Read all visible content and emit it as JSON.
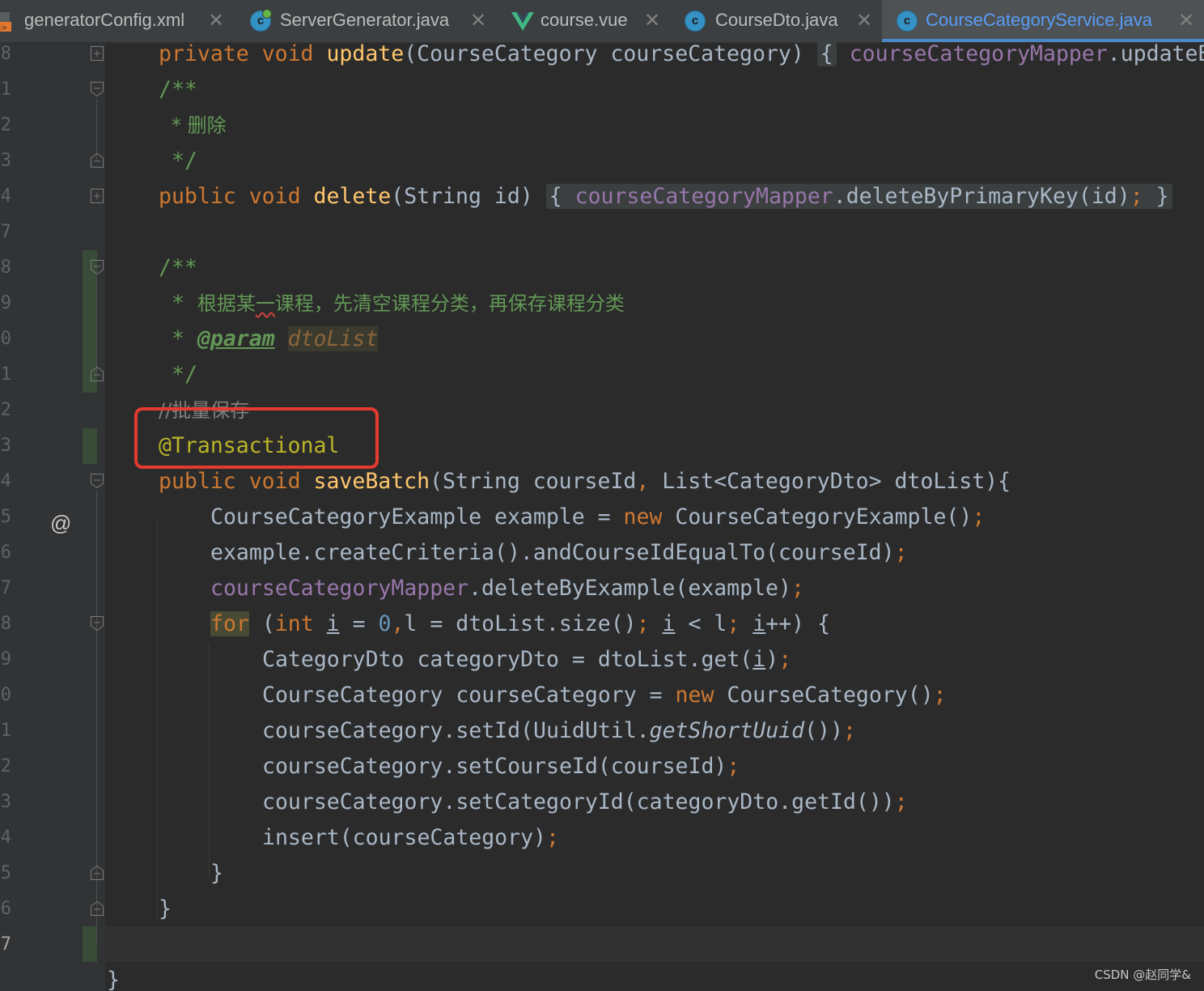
{
  "tabs": [
    {
      "label": "generatorConfig.xml",
      "icon": "xml-file-icon"
    },
    {
      "label": "ServerGenerator.java",
      "icon": "java-class-runnable-icon"
    },
    {
      "label": "course.vue",
      "icon": "vue-file-icon"
    },
    {
      "label": "CourseDto.java",
      "icon": "java-class-icon"
    },
    {
      "label": "CourseCategoryService.java",
      "icon": "java-class-icon",
      "active": true
    }
  ],
  "gutter": {
    "line_numbers": [
      "8",
      "1",
      "2",
      "3",
      "4",
      "7",
      "8",
      "9",
      "0",
      "1",
      "2",
      "3",
      "4",
      "5",
      "6",
      "7",
      "8",
      "9",
      "0",
      "1",
      "2",
      "3",
      "4",
      "5",
      "6",
      "7",
      ""
    ],
    "override_marker": "@"
  },
  "code": {
    "update_sig": {
      "kw1": "private",
      "kw2": "void",
      "name": "update",
      "open": "(CourseCategory courseCategory)",
      "brace": "{",
      "field": "courseCategoryMapper",
      "rest": ".updateB"
    },
    "doc1_open": "/**",
    "doc1_text": "* 删除",
    "doc1_close": "*/",
    "delete_sig": {
      "kw1": "public",
      "kw2": "void",
      "name": "delete",
      "params": "(String id)",
      "brace_open": "{",
      "field": "courseCategoryMapper",
      "call": ".deleteByPrimaryKey(id)",
      "semi": ";",
      "brace_close": "}"
    },
    "doc2_open": "/**",
    "doc2_text_star": "* ",
    "doc2_text_a": "根据某",
    "doc2_text_b": "一",
    "doc2_text_c": "课程，先清空课程分类，再保存课程分类",
    "doc2_param_star": "* ",
    "doc2_param_tag": "@param",
    "doc2_param_name": "dtoList",
    "doc2_close": "*/",
    "line_comment": "//批量保存",
    "annotation": "@Transactional",
    "save_sig": {
      "kw1": "public",
      "kw2": "void",
      "name": "saveBatch",
      "params_a": "(String courseId",
      "comma": ",",
      "params_b": " List<CategoryDto> dtoList){"
    },
    "l_example": {
      "a": "CourseCategoryExample example = ",
      "kw": "new",
      "b": " CourseCategoryExample()",
      "semi": ";"
    },
    "l_criteria": {
      "a": "example.createCriteria().andCourseIdEqualTo(courseId)",
      "semi": ";"
    },
    "l_delete": {
      "field": "courseCategoryMapper",
      "b": ".deleteByExample(example)",
      "semi": ";"
    },
    "l_for": {
      "kw": "for",
      "p1": " (",
      "int": "int",
      "sp": " ",
      "i1": "i",
      "eq": " = ",
      "zero": "0",
      "comma": ",",
      "l": "l = dtoList.size()",
      "semi1": ";",
      "sp2": " ",
      "i2": "i",
      "lt": " < l",
      "semi2": ";",
      "sp3": " ",
      "i3": "i",
      "inc": "++) {"
    },
    "l_get": {
      "a": "CategoryDto categoryDto = dtoList.get(",
      "i": "i",
      "b": ")",
      "semi": ";"
    },
    "l_new": {
      "a": "CourseCategory courseCategory = ",
      "kw": "new",
      "b": " CourseCategory()",
      "semi": ";"
    },
    "l_setid": {
      "a": "courseCategory.setId(UuidUtil.",
      "ital": "getShortUuid",
      "b": "())",
      "semi": ";"
    },
    "l_setcourse": {
      "a": "courseCategory.setCourseId(courseId)",
      "semi": ";"
    },
    "l_setcat": {
      "a": "courseCategory.setCategoryId(categoryDto.getId())",
      "semi": ";"
    },
    "l_insert": {
      "a": "insert(courseCategory)",
      "semi": ";"
    },
    "close_for": "}",
    "close_method": "}",
    "close_class": "}"
  },
  "watermark": "CSDN @赵同学&",
  "colors": {
    "keyword": "#cc7832",
    "method": "#ffc66d",
    "field": "#9876aa",
    "number": "#6897bb",
    "doc_comment": "#629755",
    "annotation": "#bbb529",
    "highlight_box": "#e33b2e"
  }
}
